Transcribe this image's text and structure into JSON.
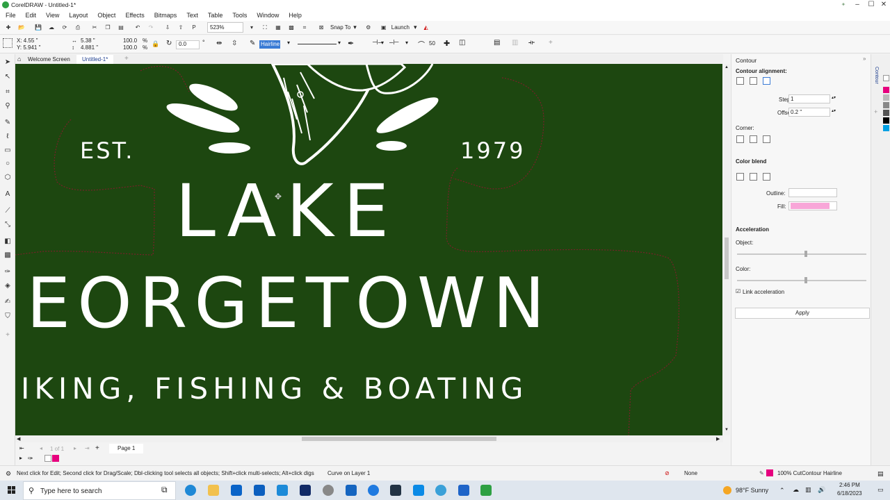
{
  "app": {
    "title": "CorelDRAW - Untitled-1*"
  },
  "menubar": [
    "File",
    "Edit",
    "View",
    "Layout",
    "Object",
    "Effects",
    "Bitmaps",
    "Text",
    "Table",
    "Tools",
    "Window",
    "Help"
  ],
  "toolbar1": {
    "zoom": "523%",
    "snap_to": "Snap To",
    "launch": "Launch"
  },
  "toolbar2": {
    "x": "X: 4.55 \"",
    "y": "Y: 5.941 \"",
    "w": "5.38 \"",
    "h": "4.881 \"",
    "scale_x": "100.0",
    "scale_y": "100.0",
    "pct": "%",
    "angle": "0.0",
    "outline_width": "Hairline",
    "size_value": "50"
  },
  "doc_tabs": {
    "welcome": "Welcome Screen",
    "doc": "Untitled-1*"
  },
  "canvas": {
    "est": "EST.",
    "year": "1979",
    "lake": "LAKE",
    "georgetown": "EORGETOWN",
    "tagline": "IKING, FISHING & BOATING"
  },
  "page_nav": {
    "pages": "1 of 1",
    "page_tab": "Page 1"
  },
  "docker": {
    "title": "Contour",
    "alignment_label": "Contour alignment:",
    "steps_label": "Steps:",
    "steps_value": "1",
    "offset_label": "Offset:",
    "offset_value": "0.2 \"",
    "corner_label": "Corner:",
    "color_blend_label": "Color blend",
    "outline_label": "Outline:",
    "fill_label": "Fill:",
    "acceleration_label": "Acceleration",
    "object_label": "Object:",
    "color_label": "Color:",
    "object_accel": 0.53,
    "color_accel": 0.53,
    "link_accel_label": "Link acceleration",
    "apply_label": "Apply",
    "tab_label": "Contour"
  },
  "statusbar": {
    "hint": "Next click for Edit; Second click for Drag/Scale; Dbl-clicking tool selects all objects; Shift+click multi-selects; Alt+click digs",
    "object_info": "Curve on Layer 1",
    "fill": "None",
    "outline": "100% CutContour  Hairline"
  },
  "taskbar": {
    "search_placeholder": "Type here to search",
    "weather": "98°F  Sunny",
    "time": "2:46 PM",
    "date": "6/18/2023"
  },
  "colors": {
    "canvas_bg": "#1d4710",
    "fill_swatch": "#f8a6d8",
    "cutcontour": "#e6007e"
  }
}
